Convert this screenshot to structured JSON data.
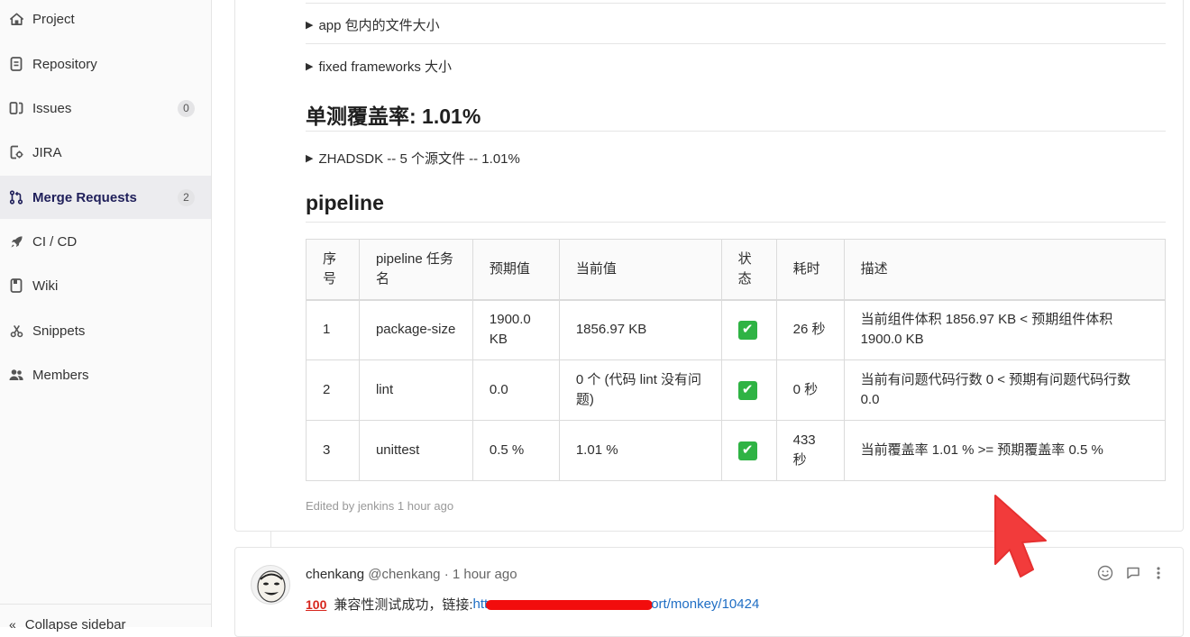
{
  "sidebar": {
    "items": [
      {
        "label": "Project",
        "icon": "home-icon"
      },
      {
        "label": "Repository",
        "icon": "document-icon"
      },
      {
        "label": "Issues",
        "icon": "issues-icon",
        "count": "0"
      },
      {
        "label": "JIRA",
        "icon": "jira-icon"
      },
      {
        "label": "Merge Requests",
        "icon": "merge-request-icon",
        "count": "2",
        "active": true
      },
      {
        "label": "CI / CD",
        "icon": "rocket-icon"
      },
      {
        "label": "Wiki",
        "icon": "book-icon"
      },
      {
        "label": "Snippets",
        "icon": "scissors-icon"
      },
      {
        "label": "Members",
        "icon": "users-icon"
      }
    ],
    "collapse_label": "Collapse sidebar"
  },
  "note": {
    "details": [
      "app 包内的文件大小",
      "fixed frameworks 大小",
      "ZHADSDK -- 5 个源文件 -- 1.01%"
    ],
    "coverage_title": "单测覆盖率: 1.01%",
    "pipeline_title": "pipeline",
    "table": {
      "headers": [
        "序号",
        "pipeline 任务名",
        "预期值",
        "当前值",
        "状态",
        "耗时",
        "描述"
      ],
      "rows": [
        {
          "id": "1",
          "task": "package-size",
          "expected": "1900.0 KB",
          "current": "1856.97 KB",
          "status": "✔",
          "duration": "26 秒",
          "desc": "当前组件体积 1856.97 KB < 预期组件体积 1900.0 KB"
        },
        {
          "id": "2",
          "task": "lint",
          "expected": "0.0",
          "current": "0 个 (代码 lint 没有问题)",
          "status": "✔",
          "duration": "0 秒",
          "desc": "当前有问题代码行数 0 < 预期有问题代码行数 0.0"
        },
        {
          "id": "3",
          "task": "unittest",
          "expected": "0.5 %",
          "current": "1.01 %",
          "status": "✔",
          "duration": "433 秒",
          "desc": "当前覆盖率 1.01 % >= 预期覆盖率 0.5 %"
        }
      ]
    },
    "edited": "Edited by jenkins 1 hour ago"
  },
  "comment": {
    "author": "chenkang",
    "handle": "@chenkang",
    "time": "· 1 hour ago",
    "emoji": "100",
    "text": "兼容性测试成功，链接:",
    "link_start": "htt",
    "link_end": "ort/monkey/10424"
  },
  "colors": {
    "accent": "#1f1f5a",
    "success": "#2fb344",
    "link": "#1f6ec4",
    "cursor": "#f23b3b"
  }
}
